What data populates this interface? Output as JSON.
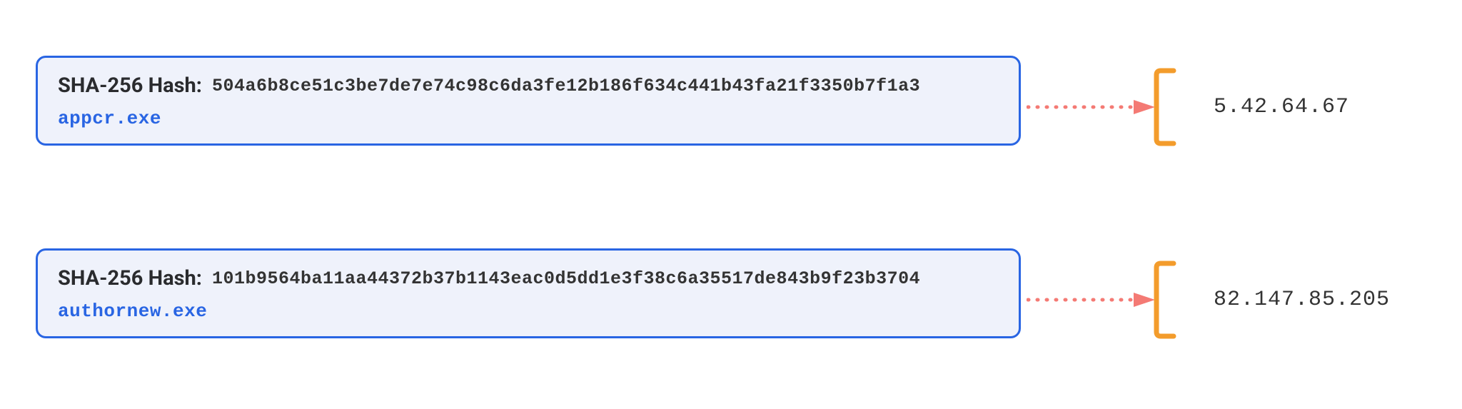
{
  "entries": [
    {
      "hash_label": "SHA-256 Hash:",
      "hash_value": "504a6b8ce51c3be7de7e74c98c6da3fe12b186f634c441b43fa21f3350b7f1a3",
      "filename": "appcr.exe",
      "ip": "5.42.64.67"
    },
    {
      "hash_label": "SHA-256 Hash:",
      "hash_value": "101b9564ba11aa44372b37b1143eac0d5dd1e3f38c6a35517de843b9f23b3704",
      "filename": "authornew.exe",
      "ip": "82.147.85.205"
    }
  ],
  "colors": {
    "box_border": "#2965e3",
    "box_fill": "#eff2fb",
    "filename": "#2965e3",
    "arrow": "#f47a74",
    "bracket": "#f39c2c",
    "text": "#333333"
  }
}
